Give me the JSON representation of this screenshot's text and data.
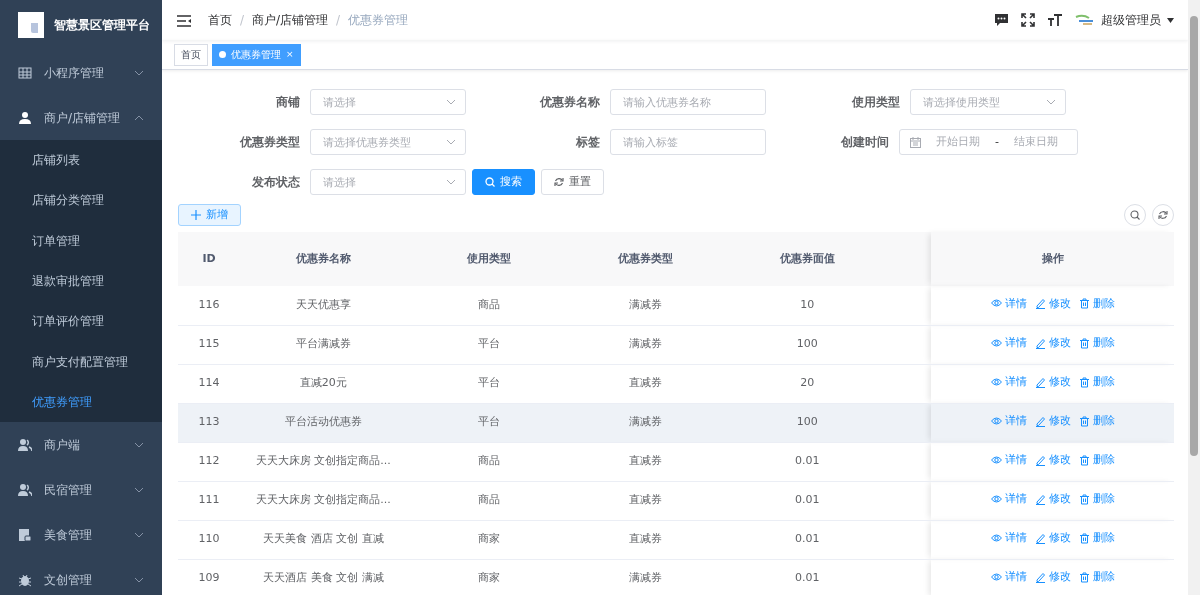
{
  "brand": {
    "title": "智慧景区管理平台"
  },
  "sidebar": {
    "items": [
      {
        "label": "小程序管理",
        "expanded": false
      },
      {
        "label": "商户/店铺管理",
        "expanded": true,
        "children": [
          {
            "label": "店铺列表",
            "selected": false
          },
          {
            "label": "店铺分类管理",
            "selected": false
          },
          {
            "label": "订单管理",
            "selected": false
          },
          {
            "label": "退款审批管理",
            "selected": false
          },
          {
            "label": "订单评价管理",
            "selected": false
          },
          {
            "label": "商户支付配置管理",
            "selected": false
          },
          {
            "label": "优惠券管理",
            "selected": true
          }
        ]
      },
      {
        "label": "商户端",
        "expanded": false
      },
      {
        "label": "民宿管理",
        "expanded": false
      },
      {
        "label": "美食管理",
        "expanded": false
      },
      {
        "label": "文创管理",
        "expanded": false
      }
    ]
  },
  "breadcrumb": [
    {
      "label": "首页"
    },
    {
      "separator": "/",
      "label": "商户/店铺管理"
    },
    {
      "separator": "/",
      "label": "优惠券管理"
    }
  ],
  "user": {
    "name": "超级管理员"
  },
  "tabs": [
    {
      "label": "首页",
      "selected": false
    },
    {
      "label": "优惠券管理",
      "selected": true,
      "close": "×"
    }
  ],
  "filters": [
    {
      "label": "商铺",
      "kind": "select",
      "placeholder": "请选择"
    },
    {
      "label": "优惠券名称",
      "kind": "input",
      "placeholder": "请输入优惠券名称"
    },
    {
      "label": "使用类型",
      "kind": "select",
      "placeholder": "请选择使用类型"
    },
    {
      "label": "优惠券类型",
      "kind": "select",
      "placeholder": "请选择优惠券类型"
    },
    {
      "label": "标签",
      "kind": "input",
      "placeholder": "请输入标签"
    },
    {
      "label": "创建时间",
      "kind": "daterange",
      "start_placeholder": "开始日期",
      "separator": "-",
      "end_placeholder": "结束日期"
    },
    {
      "label": "发布状态",
      "kind": "select",
      "placeholder": "请选择"
    }
  ],
  "buttons": {
    "search": "搜索",
    "reset": "重置",
    "add": "新增"
  },
  "table": {
    "columns": [
      "ID",
      "优惠券名称",
      "使用类型",
      "优惠券类型",
      "优惠券面值",
      "操作"
    ],
    "rows": [
      {
        "cells": [
          "116",
          "天天优惠享",
          "商品",
          "满减券",
          "10"
        ],
        "actions": [
          "详情",
          "修改",
          "删除"
        ],
        "hovered": false
      },
      {
        "cells": [
          "115",
          "平台满减券",
          "平台",
          "满减券",
          "100"
        ],
        "actions": [
          "详情",
          "修改",
          "删除"
        ],
        "hovered": false
      },
      {
        "cells": [
          "114",
          "直减20元",
          "平台",
          "直减券",
          "20"
        ],
        "actions": [
          "详情",
          "修改",
          "删除"
        ],
        "hovered": false
      },
      {
        "cells": [
          "113",
          "平台活动优惠券",
          "平台",
          "满减券",
          "100"
        ],
        "actions": [
          "详情",
          "修改",
          "删除"
        ],
        "hovered": true
      },
      {
        "cells": [
          "112",
          "天天大床房 文创指定商品...",
          "商品",
          "直减券",
          "0.01"
        ],
        "actions": [
          "详情",
          "修改",
          "删除"
        ],
        "hovered": false
      },
      {
        "cells": [
          "111",
          "天天大床房 文创指定商品...",
          "商品",
          "直减券",
          "0.01"
        ],
        "actions": [
          "详情",
          "修改",
          "删除"
        ],
        "hovered": false
      },
      {
        "cells": [
          "110",
          "天天美食 酒店 文创 直减",
          "商家",
          "直减券",
          "0.01"
        ],
        "actions": [
          "详情",
          "修改",
          "删除"
        ],
        "hovered": false
      },
      {
        "cells": [
          "109",
          "天天酒店 美食 文创 满减",
          "商家",
          "满减券",
          "0.01"
        ],
        "actions": [
          "详情",
          "修改",
          "删除"
        ],
        "hovered": false
      }
    ]
  }
}
